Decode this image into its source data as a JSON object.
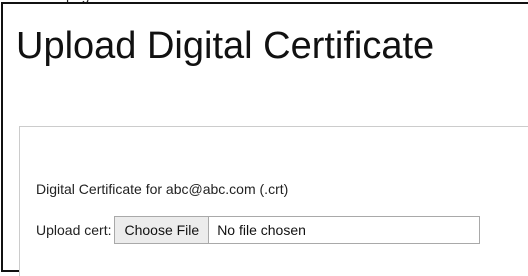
{
  "page": {
    "title": "Upload Digital Certificate"
  },
  "form": {
    "certificate_label": "Digital Certificate for abc@abc.com (.crt)",
    "upload_label": "Upload cert:",
    "choose_button_label": "Choose File",
    "file_status": "No file chosen"
  }
}
